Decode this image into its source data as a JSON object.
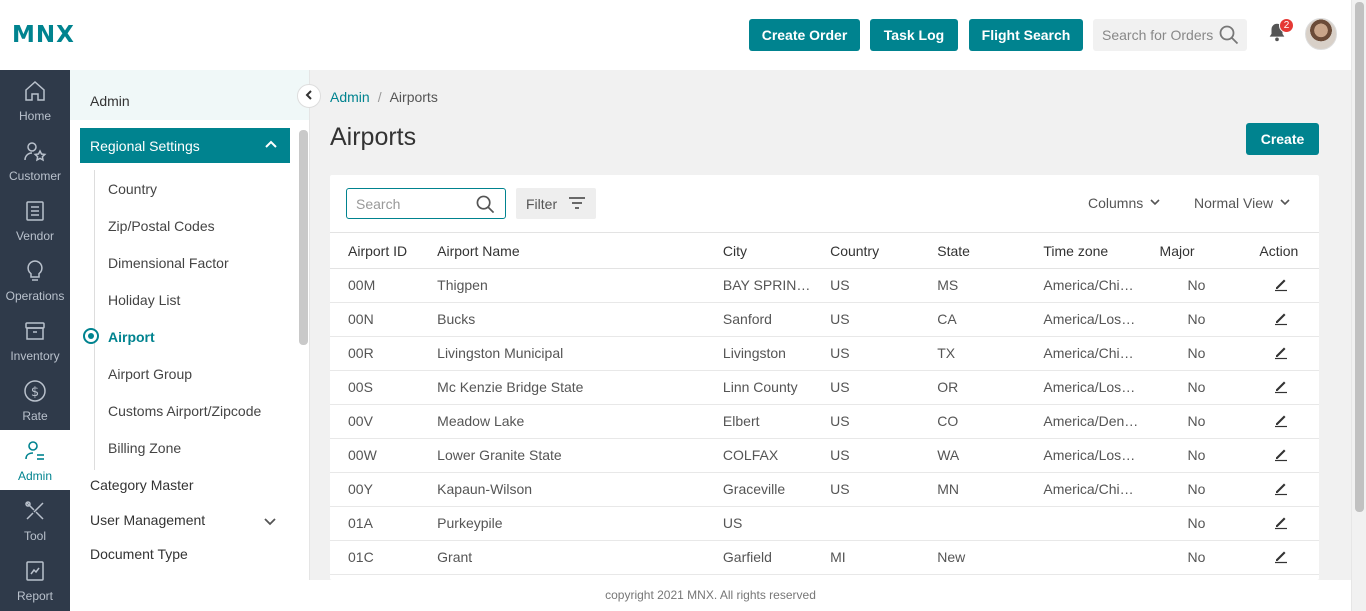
{
  "header": {
    "logo": "MNX",
    "buttons": [
      "Create Order",
      "Task Log",
      "Flight Search"
    ],
    "search_placeholder": "Search for Orders",
    "notification_count": "2"
  },
  "rail": [
    {
      "label": "Home",
      "icon": "home-icon"
    },
    {
      "label": "Customer",
      "icon": "customer-icon"
    },
    {
      "label": "Vendor",
      "icon": "vendor-icon"
    },
    {
      "label": "Operations",
      "icon": "operations-icon"
    },
    {
      "label": "Inventory",
      "icon": "inventory-icon"
    },
    {
      "label": "Rate",
      "icon": "rate-icon"
    },
    {
      "label": "Admin",
      "icon": "admin-icon",
      "active": true
    },
    {
      "label": "Tool",
      "icon": "tool-icon"
    },
    {
      "label": "Report",
      "icon": "report-icon"
    }
  ],
  "sidebar": {
    "title": "Admin",
    "group": "Regional Settings",
    "sub_items": [
      "Country",
      "Zip/Postal Codes",
      "Dimensional Factor",
      "Holiday List",
      "Airport",
      "Airport Group",
      "Customs Airport/Zipcode",
      "Billing Zone"
    ],
    "active_item": "Airport",
    "top_items": [
      "Category Master",
      "User Management",
      "Document Type"
    ]
  },
  "breadcrumb": {
    "parent": "Admin",
    "separator": "/",
    "current": "Airports"
  },
  "page": {
    "title": "Airports",
    "create_label": "Create"
  },
  "toolbar": {
    "search_placeholder": "Search",
    "filter_label": "Filter",
    "columns_label": "Columns",
    "view_label": "Normal View"
  },
  "table": {
    "headers": [
      "Airport ID",
      "Airport Name",
      "City",
      "Country",
      "State",
      "Time zone",
      "Major",
      "Action"
    ],
    "rows": [
      [
        "00M",
        "Thigpen",
        "BAY SPRINGS",
        "US",
        "MS",
        "America/Chicago",
        "No"
      ],
      [
        "00N",
        "Bucks",
        "Sanford",
        "US",
        "CA",
        "America/Los_Angeles",
        "No"
      ],
      [
        "00R",
        "Livingston Municipal",
        "Livingston",
        "US",
        "TX",
        "America/Chicago",
        "No"
      ],
      [
        "00S",
        "Mc Kenzie Bridge State",
        "Linn County",
        "US",
        "OR",
        "America/Los_Angeles",
        "No"
      ],
      [
        "00V",
        "Meadow Lake",
        "Elbert",
        "US",
        "CO",
        "America/Denver",
        "No"
      ],
      [
        "00W",
        "Lower Granite State",
        "COLFAX",
        "US",
        "WA",
        "America/Los_Angeles",
        "No"
      ],
      [
        "00Y",
        "Kapaun-Wilson",
        "Graceville",
        "US",
        "MN",
        "America/Chicago",
        "No"
      ],
      [
        "01A",
        "Purkeypile",
        "US",
        "",
        "",
        "",
        "No"
      ],
      [
        "01C",
        "Grant",
        "Garfield",
        "MI",
        "New",
        "",
        "No"
      ]
    ]
  },
  "footer": {
    "text": "copyright 2021 MNX. All rights reserved"
  },
  "colors": {
    "accent": "#00838f",
    "rail": "#2f3a4a"
  }
}
